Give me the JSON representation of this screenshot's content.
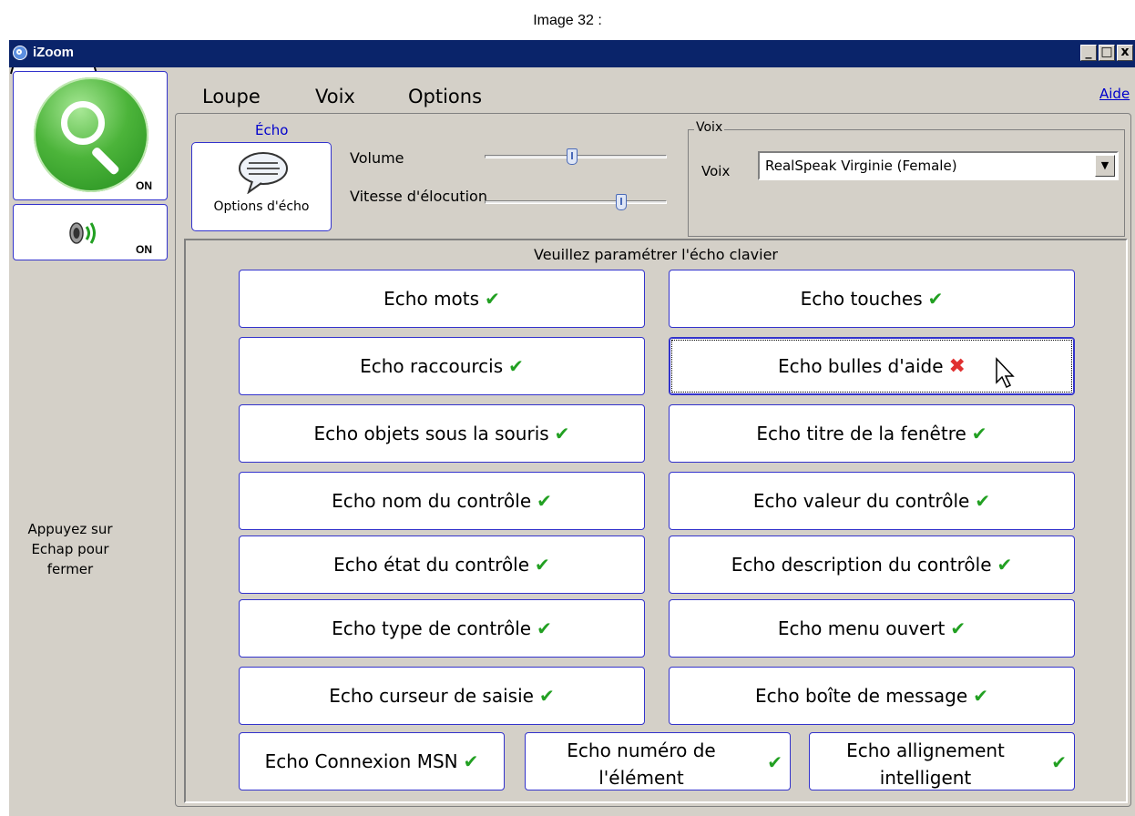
{
  "caption": "Image  32 :",
  "window": {
    "title": "iZoom",
    "buttons": {
      "minimize": "_",
      "maximize": "□",
      "close": "x"
    }
  },
  "sidebar": {
    "magnifier_status": "ON",
    "voice_status": "ON",
    "escape_hint_line1": "Appuyez sur",
    "escape_hint_line2": "Echap pour",
    "escape_hint_line3": "fermer"
  },
  "tabs": [
    {
      "label": "Loupe",
      "active": false
    },
    {
      "label": "Voix",
      "active": true
    },
    {
      "label": "Options",
      "active": false
    }
  ],
  "help_link": "Aide",
  "echo_section": {
    "caption": "Écho",
    "button_label": "Options d'écho"
  },
  "sliders": {
    "volume": {
      "label": "Volume",
      "value_fraction": 0.48
    },
    "speech_rate": {
      "label": "Vitesse d'élocution",
      "value_fraction": 0.75
    }
  },
  "voice_group": {
    "legend": "Voix",
    "label": "Voix",
    "selected": "RealSpeak Virginie (Female)"
  },
  "keyboard_echo": {
    "title": "Veuillez paramétrer l'écho clavier",
    "options": [
      {
        "label": "Echo mots",
        "enabled": true
      },
      {
        "label": "Echo touches",
        "enabled": true
      },
      {
        "label": "Echo raccourcis",
        "enabled": true
      },
      {
        "label": "Echo bulles d'aide",
        "enabled": false
      },
      {
        "label": "Echo objets sous la souris",
        "enabled": true
      },
      {
        "label": "Echo titre de la fenêtre",
        "enabled": true
      },
      {
        "label": "Echo nom du contrôle",
        "enabled": true
      },
      {
        "label": "Echo valeur du contrôle",
        "enabled": true
      },
      {
        "label": "Echo état du contrôle",
        "enabled": true
      },
      {
        "label": "Echo description du contrôle",
        "enabled": true
      },
      {
        "label": "Echo type de contrôle",
        "enabled": true
      },
      {
        "label": "Echo menu ouvert",
        "enabled": true
      },
      {
        "label": "Echo curseur de saisie",
        "enabled": true
      },
      {
        "label": "Echo boîte de message",
        "enabled": true
      },
      {
        "label": "Echo Connexion MSN",
        "enabled": true
      },
      {
        "label_line1": "Echo numéro de",
        "label_line2": "l'élément",
        "enabled": true
      },
      {
        "label_line1": "Echo allignement",
        "label_line2": "intelligent",
        "enabled": true
      }
    ]
  },
  "icons": {
    "check": "✔",
    "cross": "✖"
  },
  "colors": {
    "titlebar": "#0a246a",
    "border_accent": "#3333cc",
    "check_green": "#22a022",
    "cross_red": "#e03030",
    "power_green": "#4cb43a"
  }
}
